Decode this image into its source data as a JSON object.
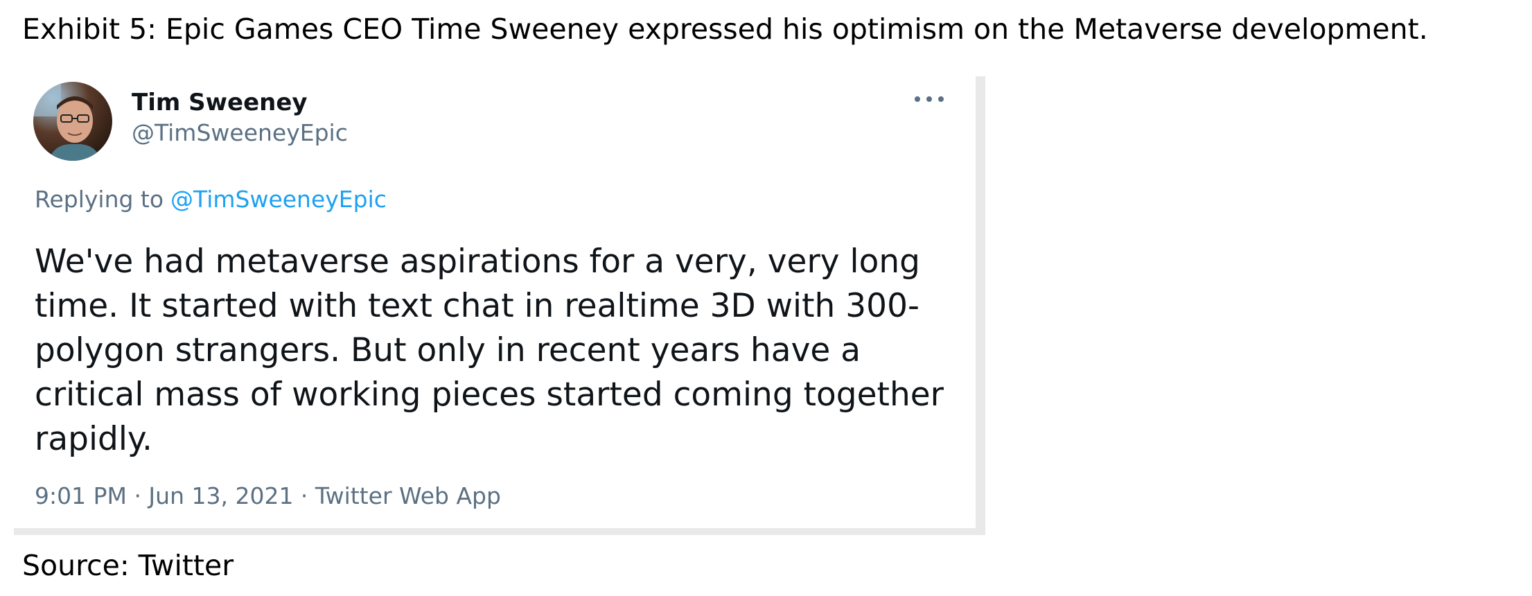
{
  "caption": "Exhibit 5: Epic Games CEO Time Sweeney expressed his optimism on the Metaverse development.",
  "tweet": {
    "author_name": "Tim Sweeney",
    "author_handle": "@TimSweeneyEpic",
    "more_icon": "more-horizontal-icon",
    "replying_to_label": "Replying to",
    "replying_to_handle": "@TimSweeneyEpic",
    "text_lines": [
      "We've had metaverse aspirations for a very, very long",
      "time. It started with text chat in realtime 3D with 300-",
      "polygon strangers. But only in recent years have a",
      "critical mass of working pieces started coming together",
      "rapidly."
    ],
    "timestamp": "9:01 PM · Jun 13, 2021 · Twitter Web App",
    "colors": {
      "mention": "#1da1f2",
      "secondary_text": "#5b7083",
      "primary_text": "#0f1419"
    }
  },
  "source": "Source: Twitter"
}
